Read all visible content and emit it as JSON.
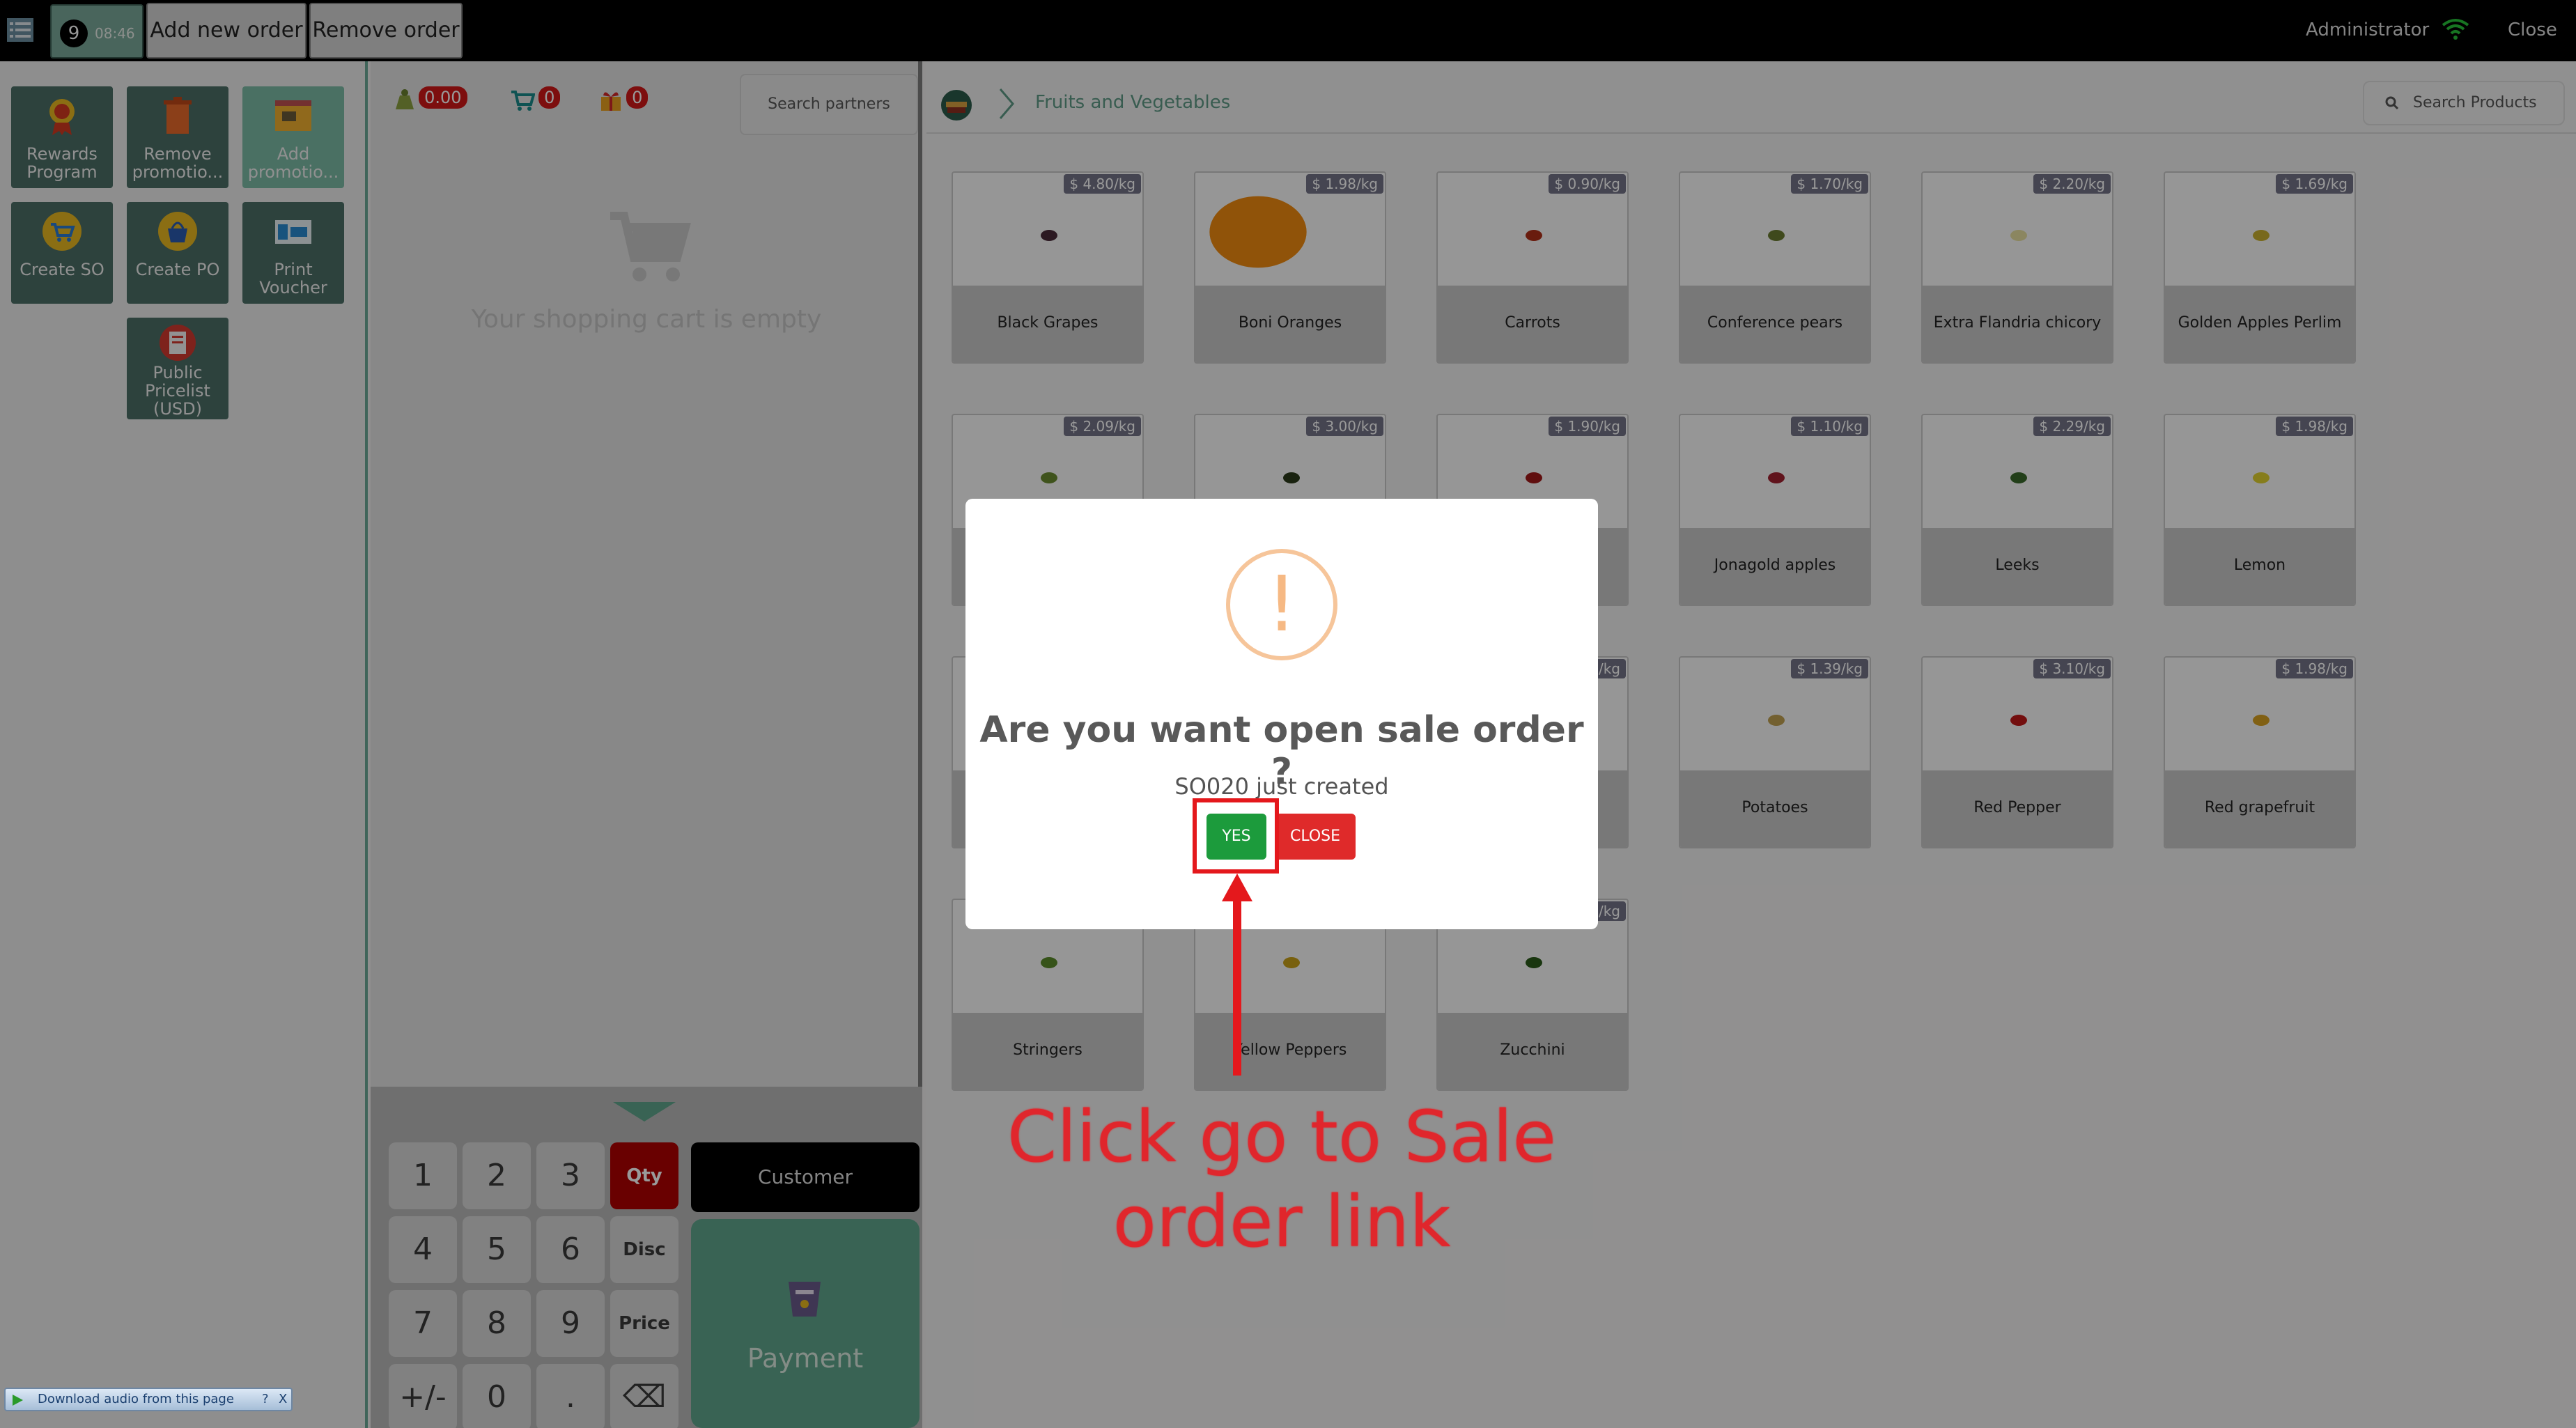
{
  "topbar": {
    "order_number": "9",
    "order_time": "08:46",
    "add_order_label": "Add new order",
    "remove_order_label": "Remove order",
    "user_label": "Administrator",
    "close_label": "Close"
  },
  "shortcuts": [
    {
      "label": "Rewards Program",
      "icon": "medal-icon"
    },
    {
      "label": "Remove promotio...",
      "icon": "trash-icon"
    },
    {
      "label": "Add promotio...",
      "icon": "add-promo-icon"
    },
    {
      "label": "Create SO",
      "icon": "cart-icon"
    },
    {
      "label": "Create PO",
      "icon": "basket-icon"
    },
    {
      "label": "Print Voucher",
      "icon": "voucher-icon"
    },
    {
      "label": "Public Pricelist (USD)",
      "icon": "pricelist-icon"
    }
  ],
  "cart": {
    "amount": "0.00",
    "cart_count": "0",
    "gift_count": "0",
    "search_placeholder": "Search partners",
    "empty_text": "Your shopping cart is empty"
  },
  "numpad": {
    "keys": [
      "1",
      "2",
      "3",
      "Qty",
      "4",
      "5",
      "6",
      "Disc",
      "7",
      "8",
      "9",
      "Price",
      "+/-",
      "0",
      ".",
      "⌫"
    ],
    "customer_label": "Customer",
    "payment_label": "Payment"
  },
  "products_header": {
    "category": "Fruits and Vegetables",
    "search_placeholder": "Search Products"
  },
  "products": [
    {
      "name": "Black Grapes",
      "price": "$ 4.80/kg",
      "color": "#4a2a3a"
    },
    {
      "name": "Boni Oranges",
      "price": "$ 1.98/kg",
      "color": "#f08a10"
    },
    {
      "name": "Carrots",
      "price": "$ 0.90/kg",
      "color": "#b03018"
    },
    {
      "name": "Conference pears",
      "price": "$ 1.70/kg",
      "color": "#6a7a30"
    },
    {
      "name": "Extra Flandria chicory",
      "price": "$ 2.20/kg",
      "color": "#e8e0a0"
    },
    {
      "name": "Golden Apples Perlim",
      "price": "$ 1.69/kg",
      "color": "#c8b030"
    },
    {
      "name": "",
      "price": "$ 2.09/kg",
      "color": "#6a8a30"
    },
    {
      "name": "",
      "price": "$ 3.00/kg",
      "color": "#2a3a1a"
    },
    {
      "name": "",
      "price": "$ 1.90/kg",
      "color": "#a01818"
    },
    {
      "name": "Jonagold apples",
      "price": "$ 1.10/kg",
      "color": "#a02030"
    },
    {
      "name": "Leeks",
      "price": "$ 2.29/kg",
      "color": "#3a6a2a"
    },
    {
      "name": "Lemon",
      "price": "$ 1.98/kg",
      "color": "#e0d030"
    },
    {
      "name": "",
      "price": "",
      "color": "#888888"
    },
    {
      "name": "",
      "price": "",
      "color": "#888888"
    },
    {
      "name": "",
      "price": "/kg",
      "color": "#888888"
    },
    {
      "name": "Potatoes",
      "price": "$ 1.39/kg",
      "color": "#c0a050"
    },
    {
      "name": "Red Pepper",
      "price": "$ 3.10/kg",
      "color": "#c01818"
    },
    {
      "name": "Red grapefruit",
      "price": "$ 1.98/kg",
      "color": "#d8a020"
    },
    {
      "name": "Stringers",
      "price": "",
      "color": "#5a8a2a"
    },
    {
      "name": "Yellow Peppers",
      "price": "",
      "color": "#c8a018"
    },
    {
      "name": "Zucchini",
      "price": "/kg",
      "color": "#2a5a1a"
    }
  ],
  "modal": {
    "icon_glyph": "!",
    "title": "Are you want open sale order ?",
    "subtitle": "SO020 just created",
    "yes_label": "YES",
    "close_label": "CLOSE"
  },
  "annotation": {
    "text": "Click go to Sale order link"
  },
  "audio_widget": {
    "label": "Download audio from this page",
    "help": "?",
    "close": "X"
  },
  "colors": {
    "accent": "#5fa58c",
    "overlay": "rgba(0,0,0,0.4)",
    "yes": "#1c9b3c",
    "close": "#df2a2a",
    "annotation": "#e0262c"
  }
}
